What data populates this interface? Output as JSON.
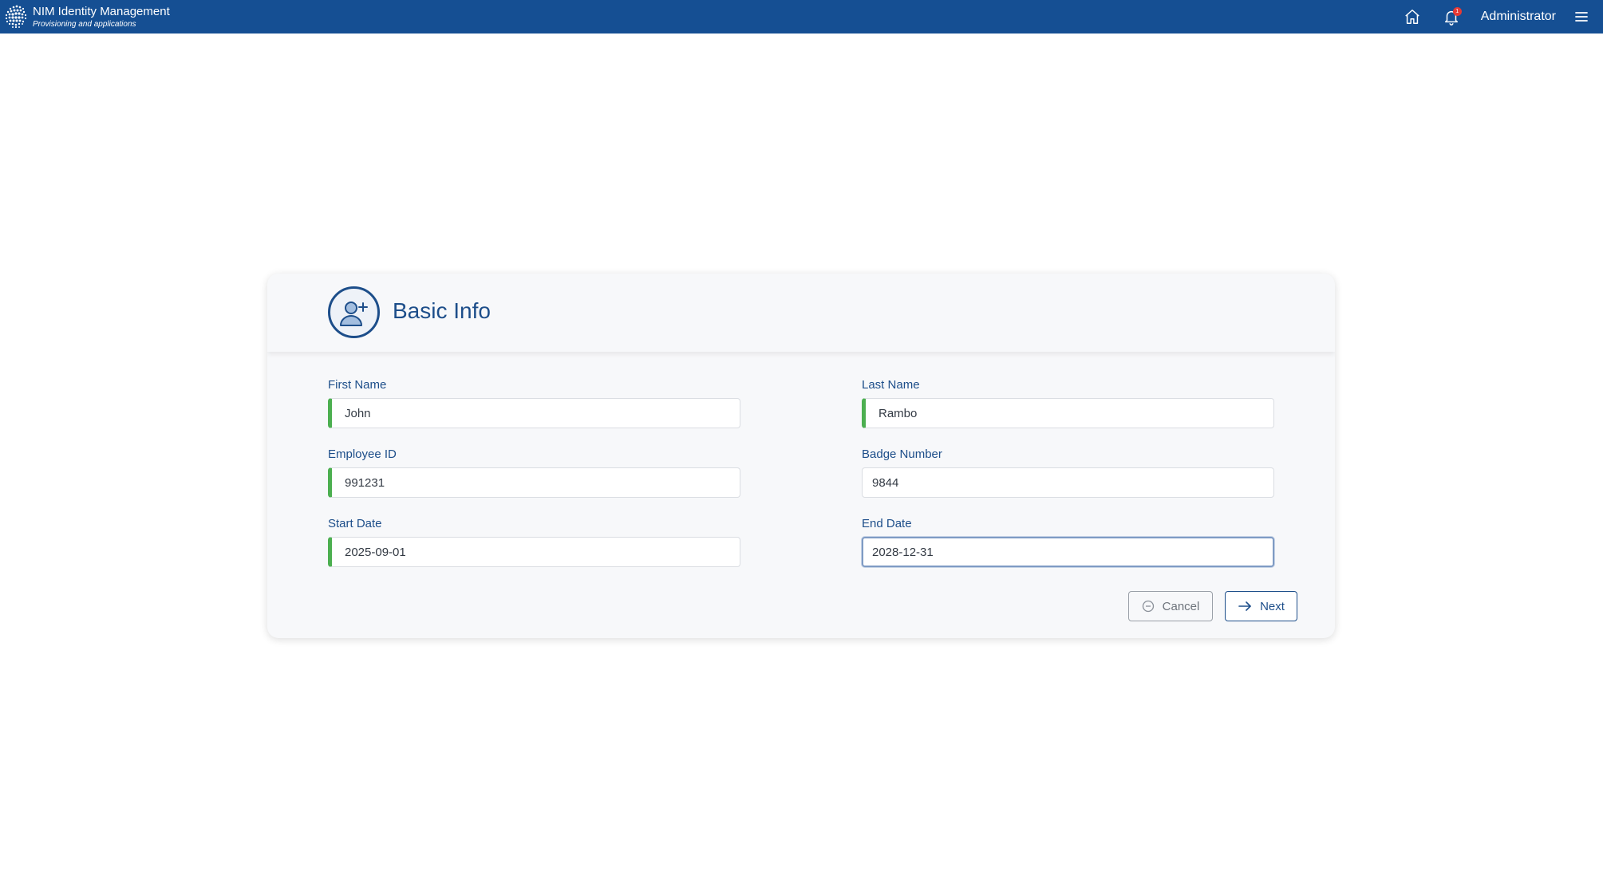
{
  "app": {
    "title": "NIM Identity Management",
    "subtitle": "Provisioning and applications"
  },
  "nav": {
    "home_icon": "home-icon",
    "bell_icon": "bell-icon",
    "notification_count": "1",
    "user": "Administrator",
    "menu_icon": "hamburger-menu-icon"
  },
  "form": {
    "title": "Basic Info",
    "header_icon": "add-user-icon",
    "fields": {
      "first_name": {
        "label": "First Name",
        "value": "John"
      },
      "last_name": {
        "label": "Last Name",
        "value": "Rambo"
      },
      "employee_id": {
        "label": "Employee ID",
        "value": "991231"
      },
      "badge_number": {
        "label": "Badge Number",
        "value": "9844"
      },
      "start_date": {
        "label": "Start Date",
        "value": "2025-09-01"
      },
      "end_date": {
        "label": "End Date",
        "value": "2028-12-31"
      }
    },
    "buttons": {
      "cancel": "Cancel",
      "next": "Next"
    }
  },
  "colors": {
    "brand": "#154f93",
    "accent": "#1d4e8a",
    "valid": "#4caf50",
    "badge": "#e53935"
  }
}
